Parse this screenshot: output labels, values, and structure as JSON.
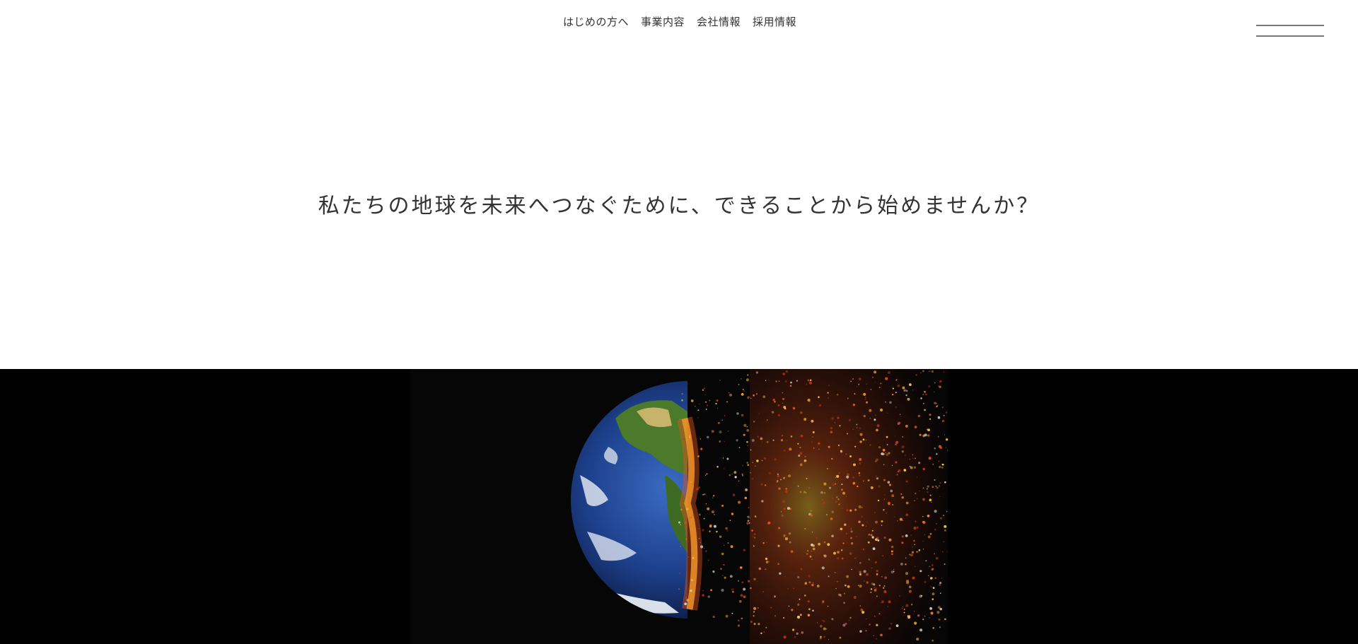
{
  "nav": {
    "items": [
      {
        "label": "はじめの方へ"
      },
      {
        "label": "事業内容"
      },
      {
        "label": "会社情報"
      },
      {
        "label": "採用情報"
      }
    ]
  },
  "menu": {
    "icon": "hamburger-menu-icon"
  },
  "hero": {
    "catchcopy": "私たちの地球を未来へつなぐために、できることから始めませんか？"
  },
  "visual": {
    "image": "earth-disintegrating-into-embers",
    "background": "#000000",
    "colors": {
      "ocean": "#1d3f8a",
      "land": "#4a7a2a",
      "ember": "#e0521a",
      "glow": "#ffcc33"
    }
  }
}
